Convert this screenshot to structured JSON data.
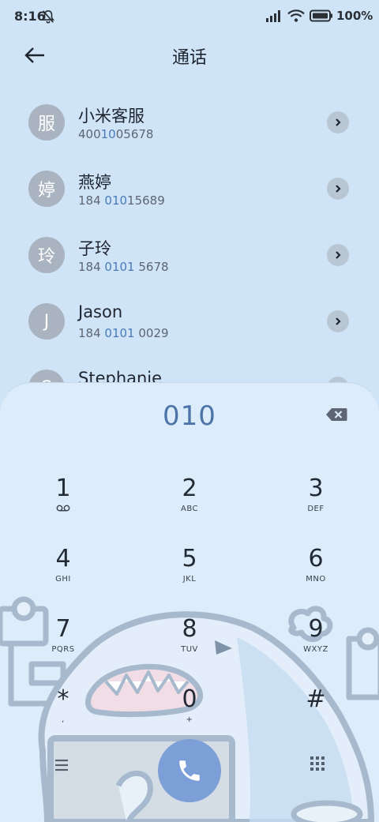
{
  "status": {
    "time": "8:16",
    "battery": "100%"
  },
  "header": {
    "title": "通话"
  },
  "contacts": [
    {
      "avatar": "服",
      "name": "小米客服",
      "pre": "400",
      "hl": "10",
      "post": "05678"
    },
    {
      "avatar": "婷",
      "name": "燕婷",
      "pre": "184 ",
      "hl": "010",
      "post": "15689"
    },
    {
      "avatar": "玲",
      "name": "子玲",
      "pre": "184 ",
      "hl": "0101",
      "post": " 5678"
    },
    {
      "avatar": "J",
      "name": "Jason",
      "pre": "184 ",
      "hl": "0101",
      "post": " 0029"
    },
    {
      "avatar": "S",
      "name": "Stephanie",
      "pre": "",
      "hl": "",
      "post": ""
    }
  ],
  "dialer": {
    "dialed": "010",
    "keys": [
      {
        "digit": "1",
        "letters": "oo"
      },
      {
        "digit": "2",
        "letters": "ABC"
      },
      {
        "digit": "3",
        "letters": "DEF"
      },
      {
        "digit": "4",
        "letters": "GHI"
      },
      {
        "digit": "5",
        "letters": "JKL"
      },
      {
        "digit": "6",
        "letters": "MNO"
      },
      {
        "digit": "7",
        "letters": "PQRS"
      },
      {
        "digit": "8",
        "letters": "TUV"
      },
      {
        "digit": "9",
        "letters": "WXYZ"
      },
      {
        "digit": "*",
        "letters": ","
      },
      {
        "digit": "0",
        "letters": "+"
      },
      {
        "digit": "#",
        "letters": ""
      }
    ]
  },
  "icons": {
    "bell": "bell-off-icon",
    "signal": "signal-icon",
    "wifi": "wifi-icon",
    "battery": "battery-icon",
    "back": "back-arrow-icon",
    "chevron": "chevron-right-icon",
    "delete": "backspace-icon",
    "menu": "menu-icon",
    "call": "phone-icon",
    "dialpad": "dialpad-icon"
  },
  "colors": {
    "background": "#cfe4f7",
    "accent": "#4c74a8",
    "call_button": "#7d9fd7"
  }
}
